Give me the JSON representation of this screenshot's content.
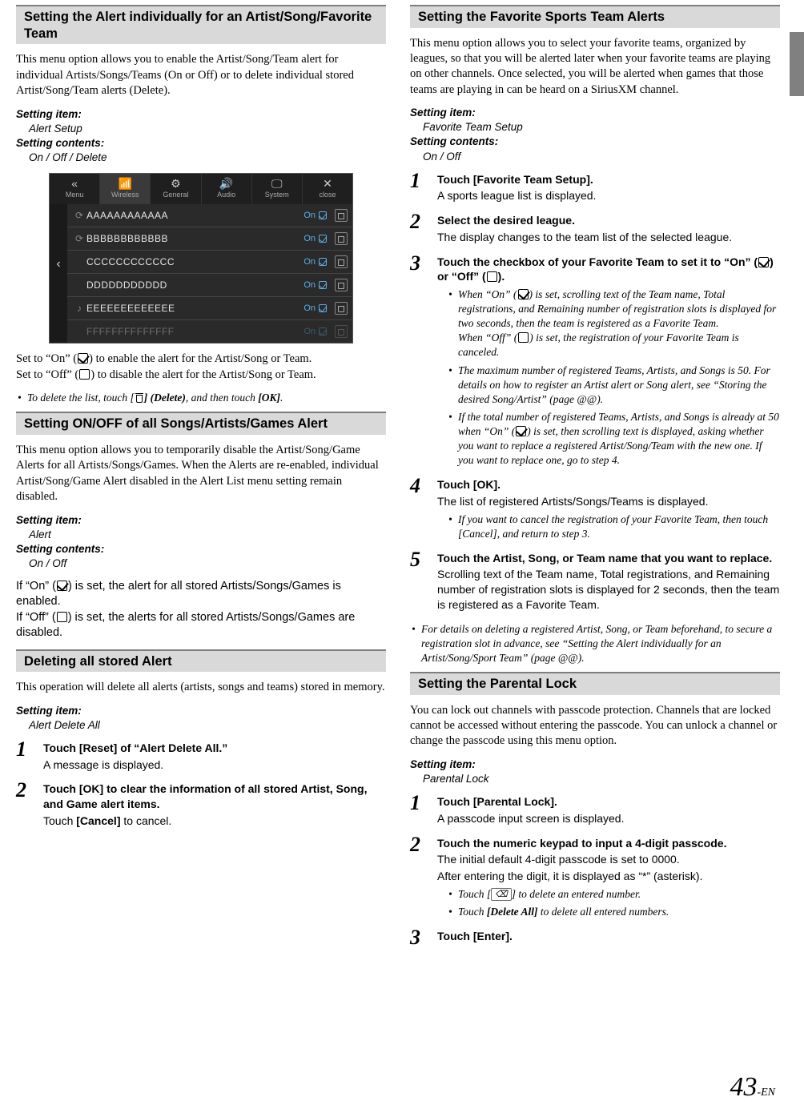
{
  "left": {
    "sec1": {
      "title": "Setting the Alert individually for an Artist/Song/Favorite Team",
      "intro": "This menu option allows you to enable the Artist/Song/Team alert for individual Artists/Songs/Teams (On or Off) or to delete individual stored Artist/Song/Team alerts (Delete).",
      "setting": {
        "lbl1": "Setting item:",
        "val1": "Alert Setup",
        "lbl2": "Setting contents:",
        "val2": "On / Off / Delete"
      },
      "shot": {
        "tabs": [
          "Menu",
          "Wireless",
          "General",
          "Audio",
          "System",
          "close"
        ],
        "tab_icons": [
          "«",
          "📶",
          "⚙",
          "🔊",
          "🖵",
          "✕"
        ],
        "rows": [
          {
            "icon": "⟳",
            "name": "AAAAAAAAAAAA",
            "stat": "On"
          },
          {
            "icon": "⟳",
            "name": "BBBBBBBBBBBB",
            "stat": "On"
          },
          {
            "icon": "",
            "name": "CCCCCCCCCCCC",
            "stat": "On",
            "back": "‹"
          },
          {
            "icon": "",
            "name": "DDDDDDDDDDD",
            "stat": "On"
          },
          {
            "icon": "♪",
            "name": "EEEEEEEEEEEEE",
            "stat": "On"
          },
          {
            "icon": "",
            "name": "FFFFFFFFFFFFFF",
            "stat": "On"
          }
        ]
      },
      "after1_a": "Set to “On” (",
      "after1_b": ") to enable the alert for the Artist/Song or Team.",
      "after2_a": "Set to “Off” (",
      "after2_b": ") to disable the alert for the Artist/Song or Team.",
      "note_a": "To delete the list, touch [",
      "note_b": "] (Delete)",
      "note_c": ", and then touch ",
      "note_d": "[OK]",
      "note_e": "."
    },
    "sec2": {
      "title": "Setting ON/OFF of all Songs/Artists/Games Alert",
      "intro": "This menu option allows you to temporarily disable the Artist/Song/Game Alerts for all Artists/Songs/Games. When the Alerts are re-enabled, individual Artist/Song/Game Alert disabled in the Alert List menu setting remain disabled.",
      "setting": {
        "lbl1": "Setting item:",
        "val1": "Alert",
        "lbl2": "Setting contents:",
        "val2": "On / Off"
      },
      "on_a": "If “On” (",
      "on_b": ") is set, the alert for all stored Artists/Songs/Games is enabled.",
      "off_a": "If “Off” (",
      "off_b": ") is set, the alerts for all stored Artists/Songs/Games are disabled."
    },
    "sec3": {
      "title": "Deleting all stored Alert",
      "intro": "This operation will delete all alerts (artists, songs and teams) stored in memory.",
      "setting": {
        "lbl1": "Setting item:",
        "val1": "Alert Delete All"
      },
      "steps": [
        {
          "head_a": "Touch [",
          "head_b": "Reset",
          "head_c": "] of “Alert Delete All.”",
          "sub": "A message is displayed."
        },
        {
          "head_a": "Touch [",
          "head_b": "OK",
          "head_c": "] to clear the information of all stored Artist, Song, and Game alert items.",
          "sub_a": "Touch ",
          "sub_b": "[Cancel]",
          "sub_c": " to cancel."
        }
      ]
    }
  },
  "right": {
    "sec4": {
      "title": "Setting the Favorite Sports Team Alerts",
      "intro": "This menu option allows you to select your favorite teams, organized by leagues, so that you will be alerted later when your favorite teams are playing on other channels. Once selected, you will be alerted when games that those teams are playing in can be heard on a SiriusXM channel.",
      "setting": {
        "lbl1": "Setting item:",
        "val1": "Favorite Team Setup",
        "lbl2": "Setting contents:",
        "val2": "On / Off"
      },
      "step1": {
        "head_a": "Touch [",
        "head_b": "Favorite Team Setup",
        "head_c": "].",
        "sub": "A sports league list is displayed."
      },
      "step2": {
        "head": "Select the desired league.",
        "sub": "The display changes to the team list of the selected league."
      },
      "step3": {
        "head_a": "Touch the checkbox of your Favorite Team to set it to “On” (",
        "head_b": ") or “Off” (",
        "head_c": ").",
        "b1_a": "When “On” (",
        "b1_b": ") is set, scrolling text of the Team name, Total registrations, and Remaining number of registration slots is displayed for two seconds, then the team is registered as a Favorite Team.",
        "b1_c": "When “Off” (",
        "b1_d": ") is set, the registration of your Favorite Team is canceled.",
        "b2": "The maximum number of registered Teams, Artists, and Songs is 50. For details on how to register an Artist alert or Song alert, see “Storing the desired Song/Artist” (page @@).",
        "b3_a": "If the total number of registered Teams, Artists, and Songs is already at 50 when “On” (",
        "b3_b": ") is set, then scrolling text is displayed, asking whether you want to replace a registered Artist/Song/Team with the new one. If you want to replace one, go to step 4."
      },
      "step4": {
        "head_a": "Touch [",
        "head_b": "OK",
        "head_c": "].",
        "sub": "The list of registered Artists/Songs/Teams is displayed.",
        "b1": "If you want to cancel the registration of your Favorite Team, then touch [Cancel], and return to step 3."
      },
      "step5": {
        "head": "Touch the Artist, Song, or Team name that you want to replace.",
        "sub": "Scrolling text of the Team name, Total registrations, and Remaining number of registration slots is displayed for 2 seconds, then the team is registered as a Favorite Team."
      },
      "tail": "For details on deleting a registered Artist, Song, or Team beforehand, to secure a registration slot in advance, see “Setting the Alert individually for an Artist/Song/Sport Team” (page @@)."
    },
    "sec5": {
      "title": "Setting the Parental Lock",
      "intro": "You can lock out channels with passcode protection. Channels that are locked cannot be accessed without entering the passcode. You can unlock a channel or change the passcode using this menu option.",
      "setting": {
        "lbl1": "Setting item:",
        "val1": "Parental Lock"
      },
      "step1": {
        "head_a": "Touch [",
        "head_b": "Parental Lock",
        "head_c": "].",
        "sub": "A passcode input screen is displayed."
      },
      "step2": {
        "head": "Touch the numeric keypad to input a 4-digit passcode.",
        "sub1": "The initial default 4-digit passcode is set to 0000.",
        "sub2": "After entering the digit, it is displayed as “*” (asterisk).",
        "b1_a": "Touch [",
        "b1_b": "] to delete an entered number.",
        "b2_a": "Touch ",
        "b2_b": "[Delete All]",
        "b2_c": " to delete all entered numbers."
      },
      "step3": {
        "head_a": "Touch [",
        "head_b": "Enter",
        "head_c": "]."
      }
    }
  },
  "footer": {
    "page": "43",
    "suffix": "-EN"
  }
}
